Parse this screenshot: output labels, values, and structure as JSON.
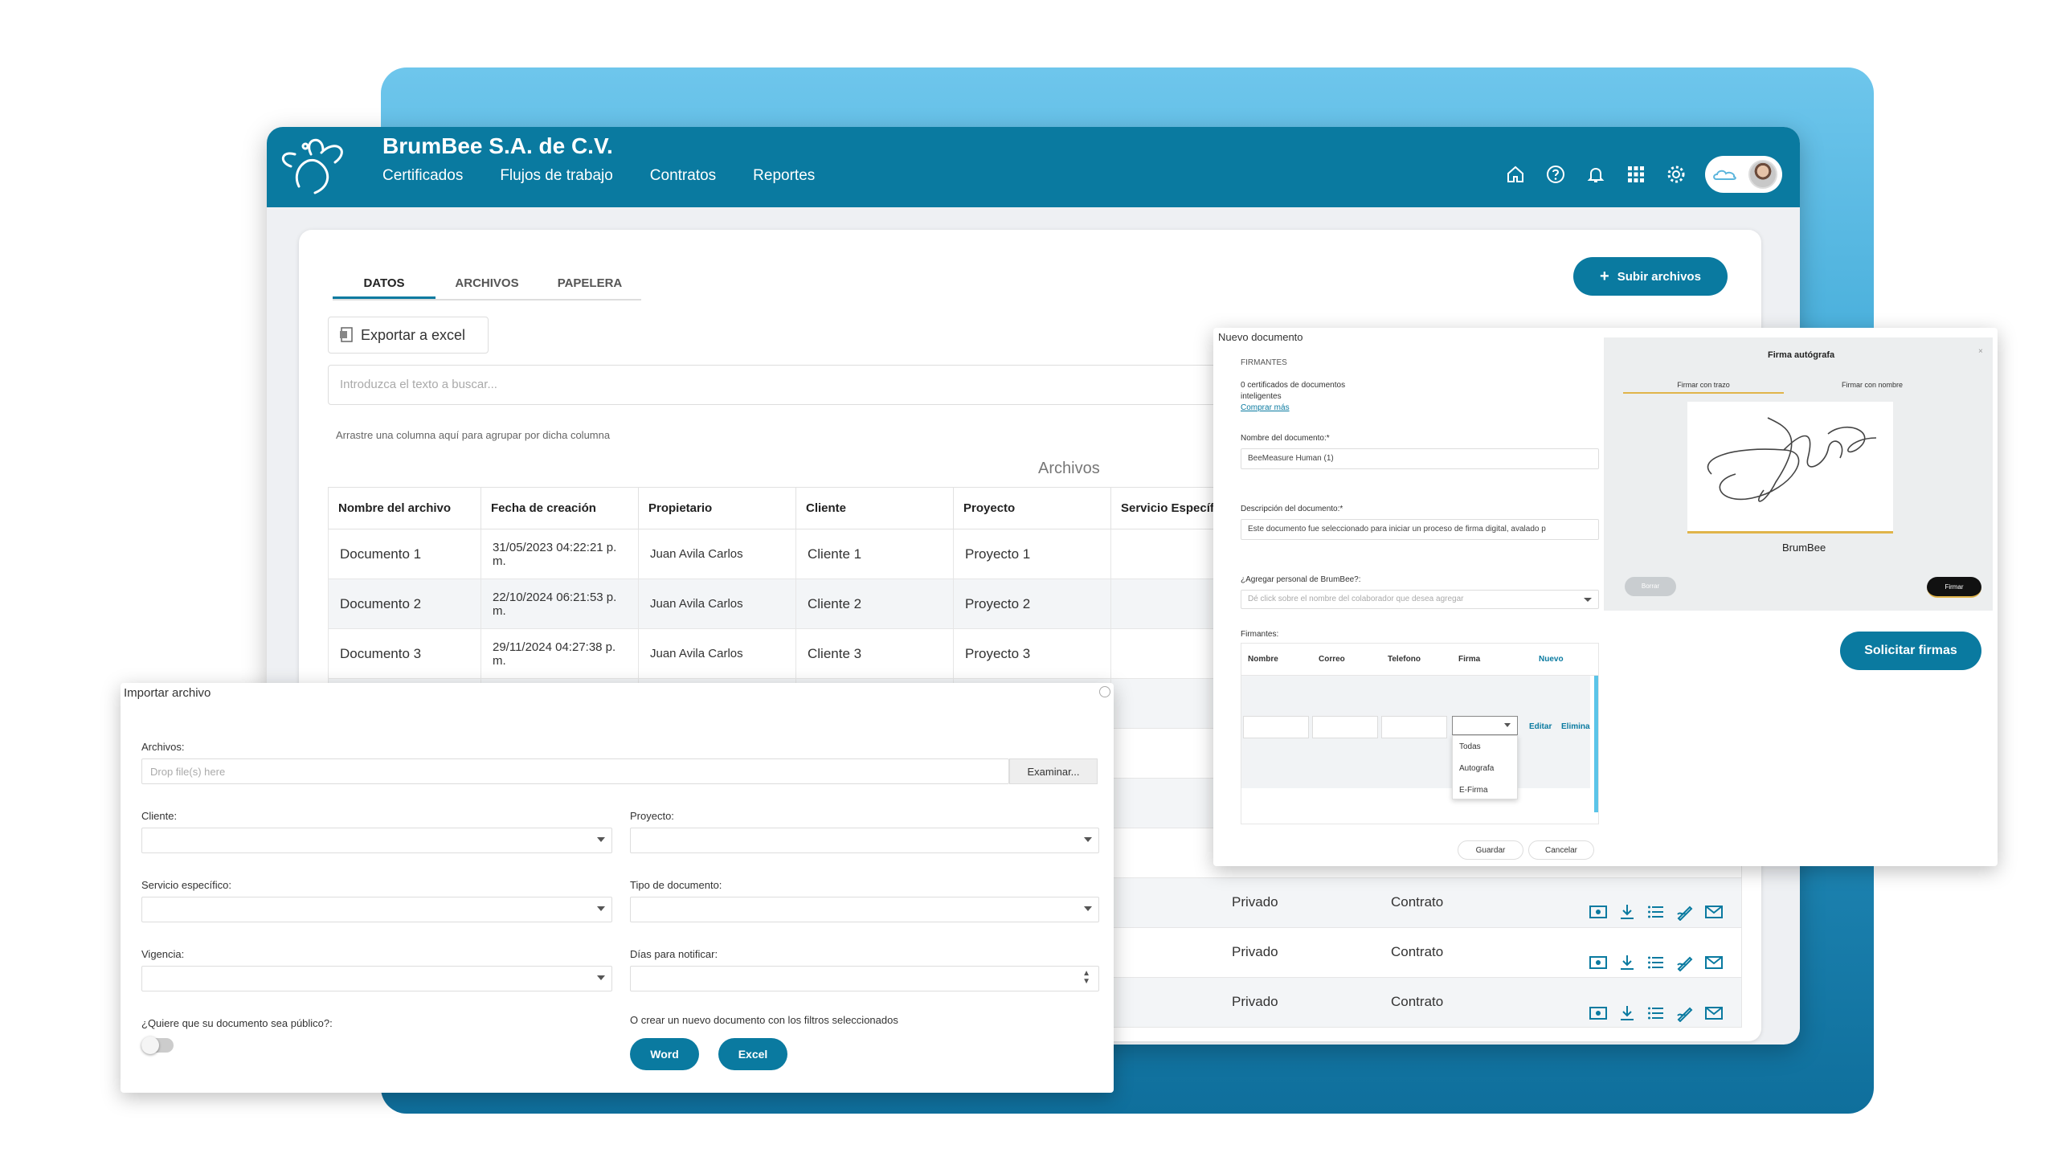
{
  "app": {
    "company": "BrumBee S.A. de C.V.",
    "nav": [
      "Certificados",
      "Flujos de trabajo",
      "Contratos",
      "Reportes"
    ],
    "icons": [
      "home-icon",
      "help-icon",
      "bell-icon",
      "apps-grid-icon",
      "gear-icon"
    ]
  },
  "tabs": [
    "DATOS",
    "ARCHIVOS",
    "PAPELERA"
  ],
  "upload_button": "Subir archivos",
  "export_button": "Exportar a excel",
  "search_placeholder": "Introduzca el texto a buscar...",
  "group_hint": "Arrastre una columna aquí para agrupar por dicha columna",
  "table_caption": "Archivos",
  "table": {
    "headers": [
      "Nombre del archivo",
      "Fecha de creación",
      "Propietario",
      "Cliente",
      "Proyecto",
      "Servicio Específico"
    ],
    "rows": [
      [
        "Documento 1",
        "31/05/2023 04:22:21 p. m.",
        "Juan Avila Carlos",
        "Cliente 1",
        "Proyecto 1"
      ],
      [
        "Documento 2",
        "22/10/2024 06:21:53 p. m.",
        "Juan Avila Carlos",
        "Cliente 2",
        "Proyecto 2"
      ],
      [
        "Documento 3",
        "29/11/2024 04:27:38 p. m.",
        "Juan Avila Carlos",
        "Cliente 3",
        "Proyecto 3"
      ]
    ],
    "extra_rows": [
      [
        "Privado",
        "Contrato"
      ],
      [
        "Privado",
        "Contrato"
      ],
      [
        "Privado",
        "Contrato"
      ]
    ]
  },
  "import_modal": {
    "title": "Importar archivo",
    "archivos_label": "Archivos:",
    "drop_placeholder": "Drop file(s) here",
    "browse": "Examinar...",
    "cliente": "Cliente:",
    "proyecto": "Proyecto:",
    "servicio": "Servicio específico:",
    "tipo": "Tipo de documento:",
    "vigencia": "Vigencia:",
    "dias": "Días para notificar:",
    "publico": "¿Quiere que su documento sea público?:",
    "crear": "O crear un nuevo documento con los filtros seleccionados",
    "word": "Word",
    "excel": "Excel"
  },
  "nuevo_modal": {
    "title": "Nuevo documento",
    "section": "FIRMANTES",
    "certs_line1": "0 certificados de documentos",
    "certs_line2": "inteligentes",
    "buy_more": "Comprar más",
    "nombre_doc_label": "Nombre del documento:*",
    "nombre_doc_value": "BeeMeasure Human (1)",
    "descripcion_label": "Descripción del documento:*",
    "descripcion_value": "Este documento fue seleccionado para iniciar un proceso de firma digital, avalado p",
    "agregar_label": "¿Agregar personal de BrumBee?:",
    "agregar_placeholder": "Dé click sobre el nombre del colaborador que desea agregar",
    "firmantes_label": "Firmantes:",
    "cols": [
      "Nombre",
      "Correo",
      "Telefono",
      "Firma",
      "Nuevo"
    ],
    "row_actions": [
      "Editar",
      "Eliminar"
    ],
    "firma_options": [
      "Todas",
      "Autografa",
      "E-Firma"
    ],
    "guardar": "Guardar",
    "cancelar": "Cancelar"
  },
  "firma_panel": {
    "title": "Firma autógrafa",
    "tab1": "Firmar con trazo",
    "tab2": "Firmar con nombre",
    "signer": "BrumBee",
    "borrar": "Borrar",
    "firmar": "Firmar"
  },
  "solicitar": "Solicitar firmas",
  "colors": {
    "primary": "#0a7aa0",
    "background": "#eef0f3"
  }
}
